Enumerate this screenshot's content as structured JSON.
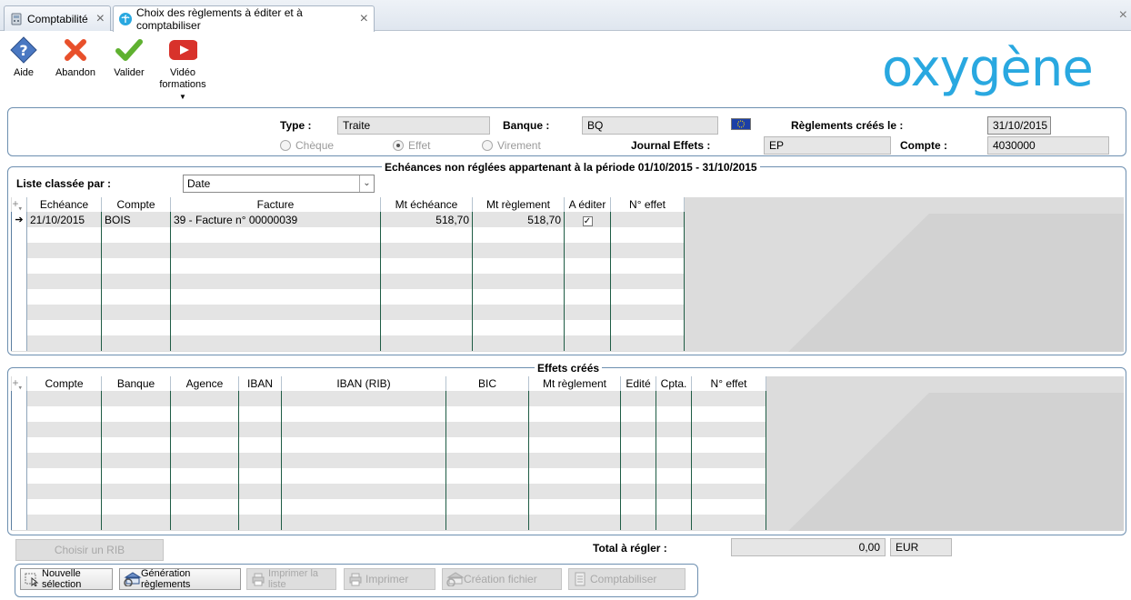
{
  "tabs": [
    {
      "label": "Comptabilité",
      "icon": "calculator-icon"
    },
    {
      "label": "Choix des règlements à éditer et à comptabiliser",
      "icon": "palm-icon"
    }
  ],
  "toolbar": {
    "aide": "Aide",
    "abandon": "Abandon",
    "valider": "Valider",
    "video": "Vidéo\nformations"
  },
  "logo": {
    "text": "oxygène",
    "color": "#29a8e0"
  },
  "form": {
    "type_label": "Type :",
    "type_value": "Traite",
    "banque_label": "Banque :",
    "banque_value": "BQ",
    "reglements_label": "Règlements créés le :",
    "reglements_value": "31/10/2015",
    "radios": [
      "Chèque",
      "Effet",
      "Virement"
    ],
    "radio_selected": "Effet",
    "journal_label": "Journal Effets :",
    "journal_value": "EP",
    "compte_label": "Compte :",
    "compte_value": "4030000"
  },
  "echeances": {
    "title": "Echéances non réglées appartenant à la période 01/10/2015 - 31/10/2015",
    "sort_label": "Liste classée par :",
    "sort_value": "Date",
    "columns": [
      "Echéance",
      "Compte",
      "Facture",
      "Mt échéance",
      "Mt règlement",
      "A éditer",
      "N° effet"
    ],
    "rows": [
      {
        "echeance": "21/10/2015",
        "compte": "BOIS",
        "facture": "39 - Facture n° 00000039",
        "mt_echeance": "518,70",
        "mt_reglement": "518,70",
        "a_editer": true,
        "n_effet": ""
      }
    ]
  },
  "effets": {
    "title": "Effets créés",
    "columns": [
      "Compte",
      "Banque",
      "Agence",
      "IBAN",
      "IBAN (RIB)",
      "BIC",
      "Mt règlement",
      "Edité",
      "Cpta.",
      "N° effet"
    ]
  },
  "bottom": {
    "choisir_rib": "Choisir un RIB",
    "total_label": "Total à régler :",
    "total_value": "0,00",
    "currency": "EUR",
    "buttons": {
      "nouvelle": "Nouvelle sélection",
      "generation": "Génération règlements",
      "imprimer_liste": "Imprimer la liste",
      "imprimer": "Imprimer",
      "creation": "Création fichier",
      "comptabiliser": "Comptabiliser"
    }
  },
  "colors": {
    "accent": "#29a8e0",
    "grid_line": "#1f5c45",
    "panel_border": "#6d8fb0"
  }
}
